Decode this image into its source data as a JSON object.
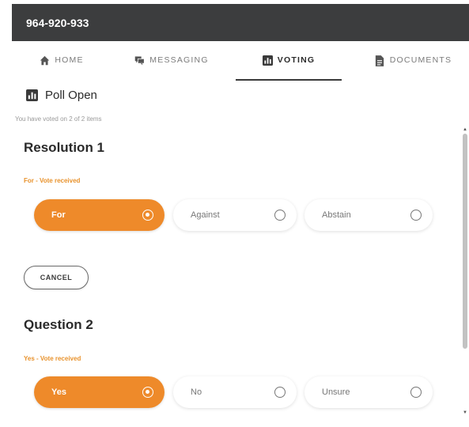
{
  "header": {
    "title": "964-920-933"
  },
  "tabs": [
    {
      "label": "HOME",
      "icon": "home-icon"
    },
    {
      "label": "MESSAGING",
      "icon": "chat-icon"
    },
    {
      "label": "VOTING",
      "icon": "bar-chart-icon",
      "active": true
    },
    {
      "label": "DOCUMENTS",
      "icon": "document-icon"
    }
  ],
  "poll": {
    "status": "Poll Open",
    "voted_text": "You have voted on 2 of 2 items",
    "items": [
      {
        "title": "Resolution 1",
        "status": "For - Vote received",
        "options": [
          {
            "label": "For",
            "selected": true
          },
          {
            "label": "Against",
            "selected": false
          },
          {
            "label": "Abstain",
            "selected": false
          }
        ],
        "cancel_label": "CANCEL"
      },
      {
        "title": "Question 2",
        "status": "Yes - Vote received",
        "options": [
          {
            "label": "Yes",
            "selected": true
          },
          {
            "label": "No",
            "selected": false
          },
          {
            "label": "Unsure",
            "selected": false
          }
        ]
      }
    ]
  },
  "colors": {
    "accent": "#ee8a2a",
    "header_bg": "#3c3d3e"
  }
}
